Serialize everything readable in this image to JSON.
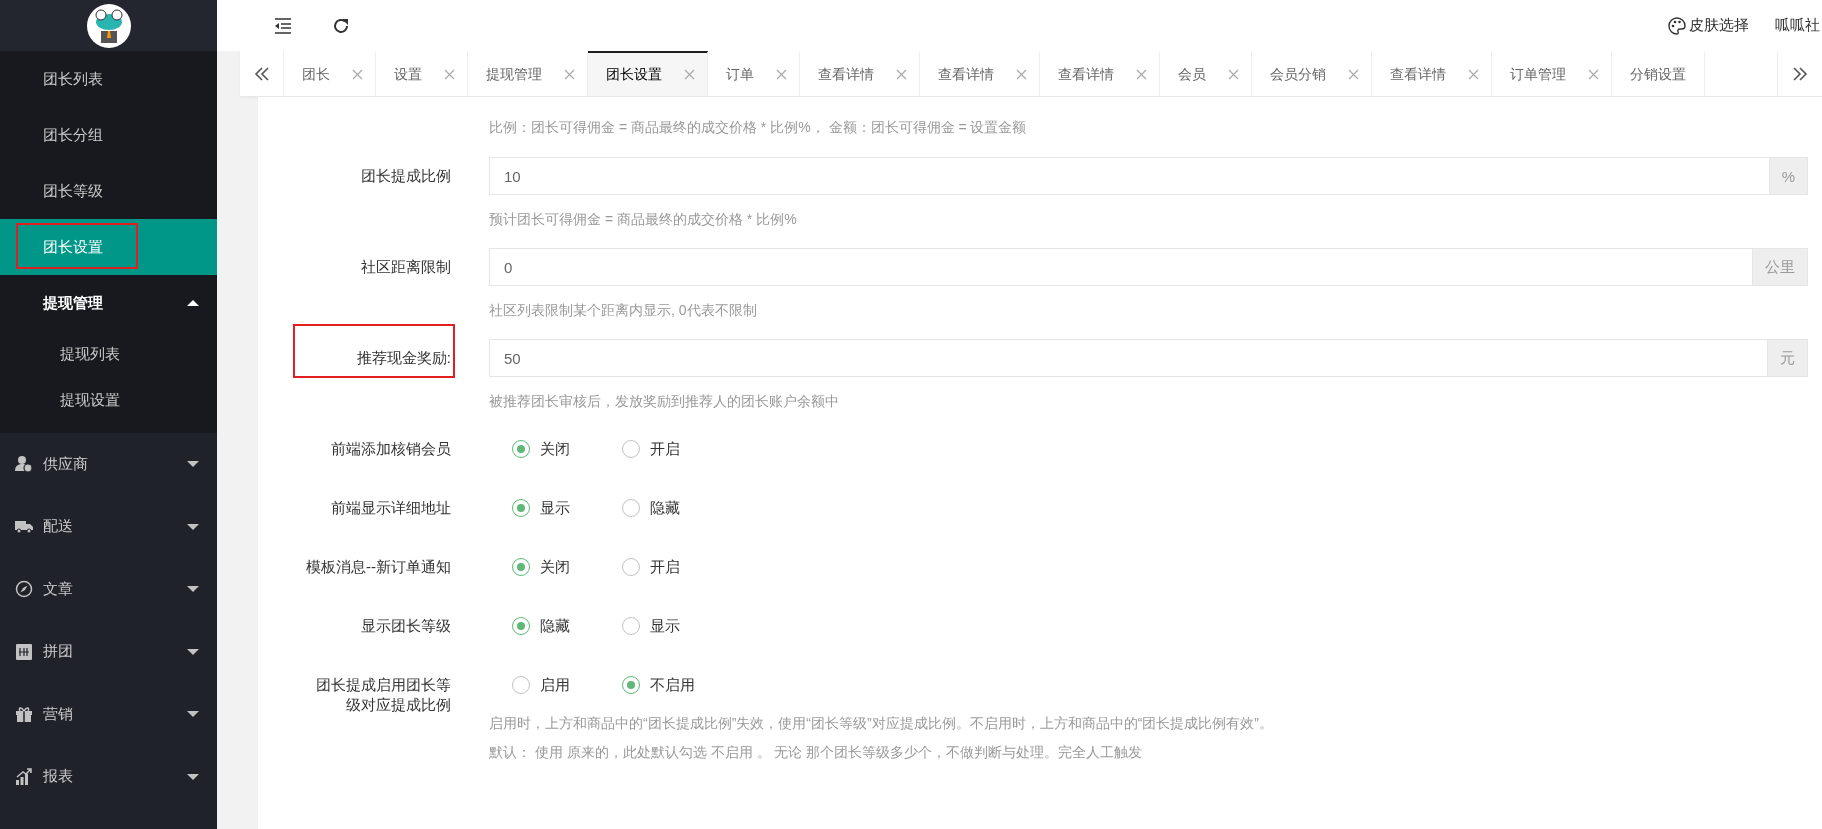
{
  "sidebar": {
    "items": [
      {
        "label": "团长列表",
        "selected": false,
        "highlighted": false
      },
      {
        "label": "团长分组",
        "selected": false,
        "highlighted": false
      },
      {
        "label": "团长等级",
        "selected": false,
        "highlighted": false
      },
      {
        "label": "团长设置",
        "selected": true,
        "highlighted": true
      },
      {
        "label": "提现管理",
        "expanded": true,
        "children": [
          {
            "label": "提现列表",
            "selected": false
          },
          {
            "label": "提现设置",
            "selected": false
          }
        ]
      }
    ],
    "menu": [
      {
        "label": "供应商",
        "expanded": false
      },
      {
        "label": "配送",
        "expanded": false
      },
      {
        "label": "文章",
        "expanded": false
      },
      {
        "label": "拼团",
        "expanded": false
      },
      {
        "label": "营销",
        "expanded": false
      },
      {
        "label": "报表",
        "expanded": false
      }
    ]
  },
  "header": {
    "skin_button": "皮肤选择",
    "user": "呱呱社"
  },
  "tabs": [
    {
      "label": "团长",
      "selected": false,
      "closable": true
    },
    {
      "label": "设置",
      "selected": false,
      "closable": true
    },
    {
      "label": "提现管理",
      "selected": false,
      "closable": true
    },
    {
      "label": "团长设置",
      "selected": true,
      "closable": true
    },
    {
      "label": "订单",
      "selected": false,
      "closable": true
    },
    {
      "label": "查看详情",
      "selected": false,
      "closable": true
    },
    {
      "label": "查看详情",
      "selected": false,
      "closable": true
    },
    {
      "label": "查看详情",
      "selected": false,
      "closable": true
    },
    {
      "label": "会员",
      "selected": false,
      "closable": true
    },
    {
      "label": "会员分销",
      "selected": false,
      "closable": true
    },
    {
      "label": "查看详情",
      "selected": false,
      "closable": true
    },
    {
      "label": "订单管理",
      "selected": false,
      "closable": true
    },
    {
      "label": "分销设置",
      "selected": false,
      "closable": false
    }
  ],
  "form": {
    "top_hint": "比例：团长可得佣金 = 商品最终的成交价格 * 比例%， 金额：团长可得佣金 = 设置金额",
    "rows": [
      {
        "kind": "input",
        "label": "团长提成比例",
        "value": "10",
        "unit": "%",
        "hints": [
          "预计团长可得佣金 = 商品最终的成交价格 * 比例%"
        ],
        "highlighted": false
      },
      {
        "kind": "input",
        "label": "社区距离限制",
        "value": "0",
        "unit": "公里",
        "hints": [
          "社区列表限制某个距离内显示, 0代表不限制"
        ],
        "highlighted": false
      },
      {
        "kind": "input",
        "label": "推荐现金奖励:",
        "value": "50",
        "unit": "元",
        "hints": [
          "被推荐团长审核后，发放奖励到推荐人的团长账户余额中"
        ],
        "highlighted": true
      },
      {
        "kind": "radio",
        "label": "前端添加核销会员",
        "options": [
          {
            "label": "关闭",
            "selected": true
          },
          {
            "label": "开启",
            "selected": false
          }
        ],
        "highlighted": false
      },
      {
        "kind": "radio",
        "label": "前端显示详细地址",
        "options": [
          {
            "label": "显示",
            "selected": true
          },
          {
            "label": "隐藏",
            "selected": false
          }
        ],
        "highlighted": false
      },
      {
        "kind": "radio",
        "label": "模板消息--新订单通知",
        "options": [
          {
            "label": "关闭",
            "selected": true
          },
          {
            "label": "开启",
            "selected": false
          }
        ],
        "highlighted": false
      },
      {
        "kind": "radio",
        "label": "显示团长等级",
        "options": [
          {
            "label": "隐藏",
            "selected": true
          },
          {
            "label": "显示",
            "selected": false
          }
        ],
        "highlighted": false
      },
      {
        "kind": "radio",
        "label": "团长提成启用团长等级对应提成比例",
        "options": [
          {
            "label": "启用",
            "selected": false
          },
          {
            "label": "不启用",
            "selected": true
          }
        ],
        "hints": [
          "启用时，上方和商品中的“团长提成比例”失效，使用“团长等级”对应提成比例。不启用时，上方和商品中的“团长提成比例有效”。",
          "默认： 使用 原来的，此处默认勾选 不启用 。 无论 那个团长等级多少个，不做判断与处理。完全人工触发"
        ],
        "highlighted": false
      }
    ]
  }
}
